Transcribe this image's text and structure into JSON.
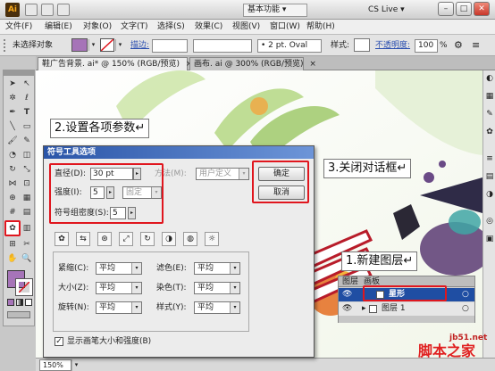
{
  "titlebar": {
    "app_logo": "Ai",
    "workspace": "基本功能 ▾",
    "cslive": "CS Live ▾",
    "minimize": "–",
    "maximize": "□",
    "close": "✕"
  },
  "menu": [
    "文件(F)",
    "编辑(E)",
    "对象(O)",
    "文字(T)",
    "选择(S)",
    "效果(C)",
    "视图(V)",
    "窗口(W)",
    "帮助(H)"
  ],
  "control": {
    "selection": "未选择对象",
    "stroke_label": "描边:",
    "brush": "• 2 pt. Oval",
    "style_label": "样式:",
    "opacity_label": "不透明度:",
    "opacity_value": "100",
    "opacity_unit": "%"
  },
  "tabs": [
    {
      "label": "鞋广告背景. ai* @ 150% (RGB/预览)",
      "close": "×"
    },
    {
      "label": "画布. ai @ 300% (RGB/预览)",
      "close": "×"
    }
  ],
  "status": {
    "zoom": "150%"
  },
  "dialog": {
    "title": "符号工具选项",
    "diameter_label": "直径(D):",
    "diameter_value": "30 pt",
    "method_label": "方法(M):",
    "method_value": "用户定义",
    "intensity_label": "强度(I):",
    "intensity_value": "5",
    "fixed_value": "固定",
    "density_label": "符号组密度(S):",
    "density_value": "5",
    "ok": "确定",
    "cancel": "取消",
    "rows": [
      {
        "left_label": "紧缩(C):",
        "left_value": "平均",
        "right_label": "滤色(E):",
        "right_value": "平均"
      },
      {
        "left_label": "大小(Z):",
        "left_value": "平均",
        "right_label": "染色(T):",
        "right_value": "平均"
      },
      {
        "left_label": "旋转(N):",
        "left_value": "平均",
        "right_label": "样式(Y):",
        "right_value": "平均"
      }
    ],
    "show_brush_label": "显示画笔大小和强度(B)"
  },
  "annotations": {
    "step2": "2.设置各项参数↵",
    "step3": "3.关闭对话框↵",
    "step1": "1.新建图层↵"
  },
  "layers": {
    "tab_layers": "图层",
    "tab_artboards": "画板",
    "rows": [
      {
        "name": "星形"
      },
      {
        "name": "图层 1"
      }
    ]
  },
  "watermark": {
    "site": "jb51.net",
    "name": "脚本之家"
  },
  "colors": {
    "accent_red": "#e0161e",
    "fill_swatch": "#a674b8",
    "dialog_title": "#2a55a8"
  }
}
